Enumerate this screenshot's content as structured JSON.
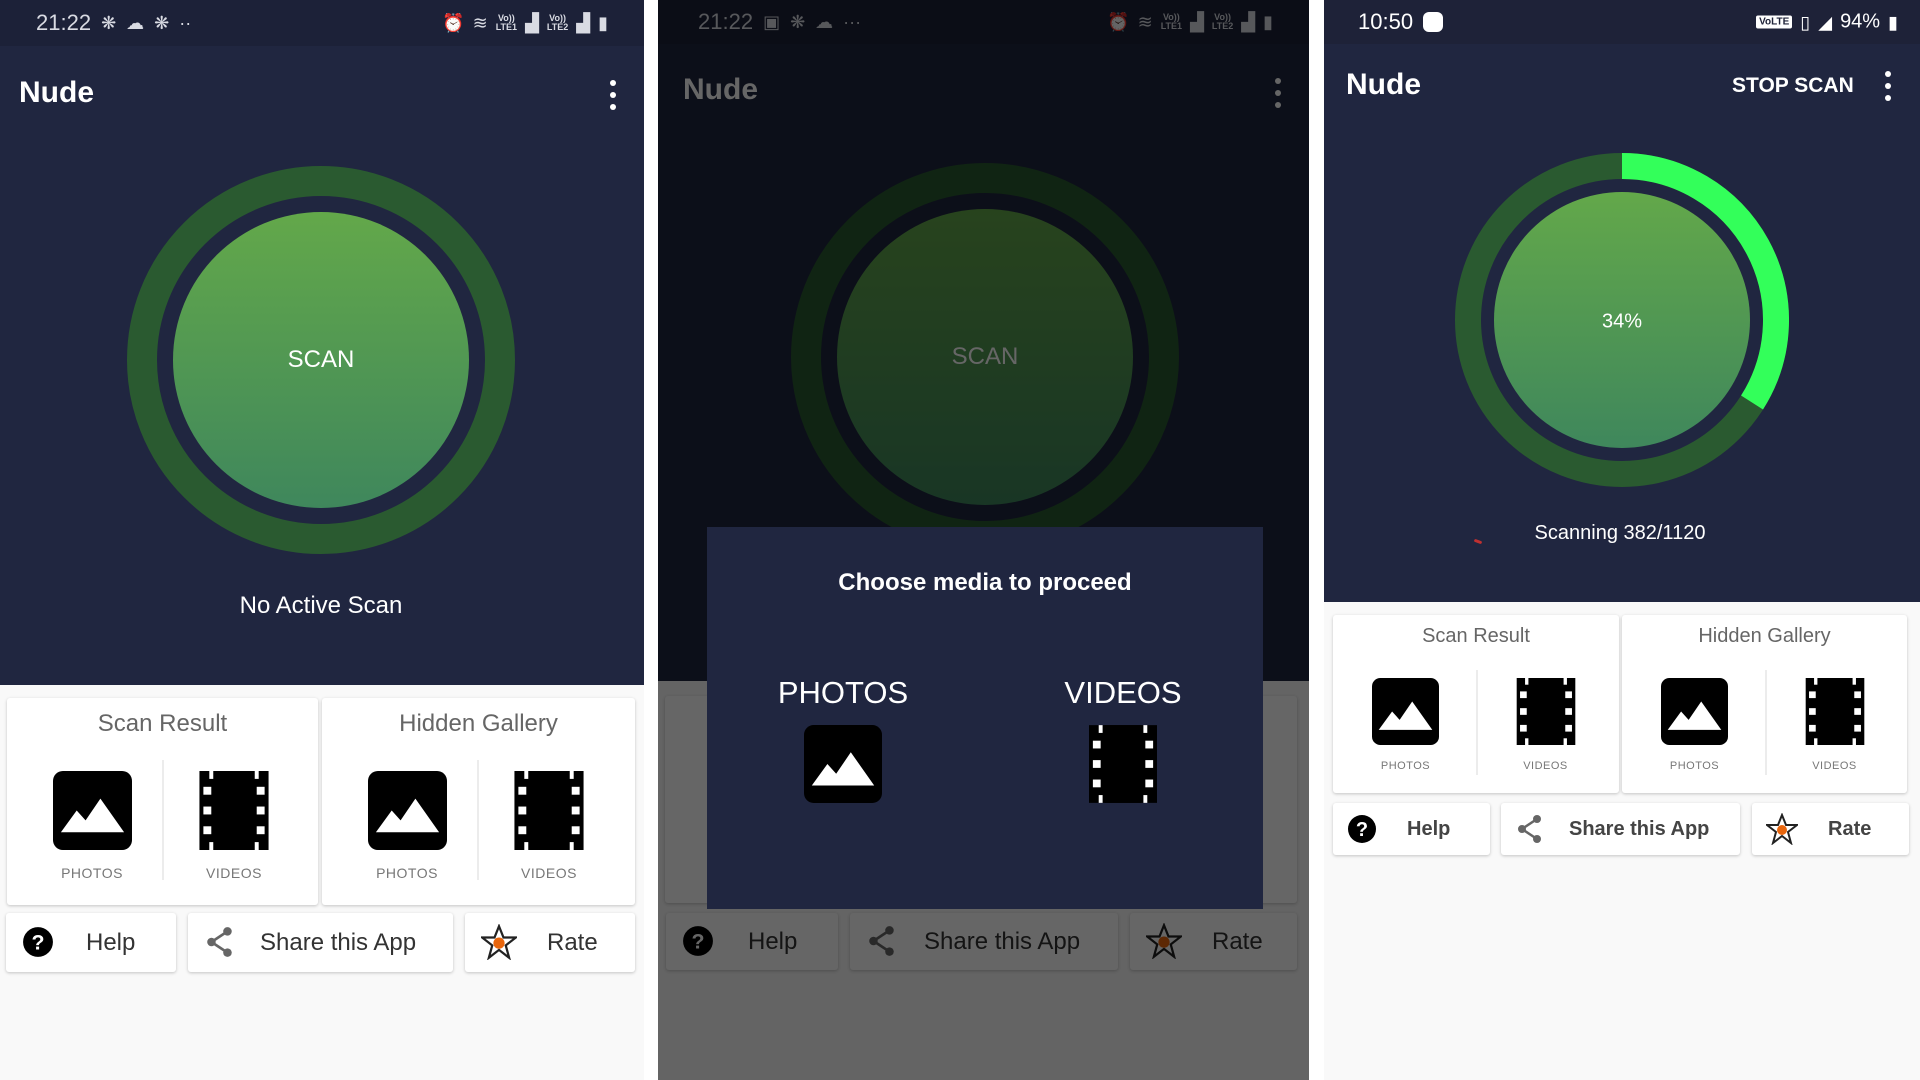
{
  "screens": [
    {
      "status": {
        "time": "21:22",
        "left_icons": [
          "snowflake-icon",
          "weather-sunrise-icon",
          "snowflake-icon",
          "more-dots-icon"
        ],
        "right_icons": [
          "alarm-icon",
          "wifi-icon",
          "volte-lte1-signal-icon",
          "volte-lte2-signal-icon",
          "battery-icon"
        ],
        "lte1": "LTE1",
        "lte2": "LTE2",
        "vol": "Vo))"
      },
      "app_title": "Nude",
      "scan_button_label": "SCAN",
      "scan_status": "No Active Scan"
    },
    {
      "status": {
        "time": "21:22",
        "left_icons": [
          "gallery-icon",
          "snowflake-icon",
          "weather-sunrise-icon",
          "more-dots-icon"
        ],
        "right_icons": [
          "alarm-icon",
          "wifi-icon",
          "volte-lte1-signal-icon",
          "volte-lte2-signal-icon",
          "battery-icon"
        ],
        "lte1": "LTE1",
        "lte2": "LTE2",
        "vol": "Vo))"
      },
      "app_title": "Nude",
      "scan_button_label": "SCAN",
      "dialog": {
        "title": "Choose media to proceed",
        "options": [
          {
            "label": "PHOTOS",
            "icon": "image-icon"
          },
          {
            "label": "VIDEOS",
            "icon": "film-icon"
          }
        ]
      }
    },
    {
      "status": {
        "time": "10:50",
        "left_icons": [
          "notification-square-icon"
        ],
        "volte_badge": "VoLTE",
        "battery_percent": "94%",
        "right_icons": [
          "volte-icon",
          "vibrate-icon",
          "no-signal-icon",
          "battery-icon"
        ]
      },
      "app_title": "Nude",
      "stop_scan_label": "STOP SCAN",
      "progress_label": "34%",
      "progress_fraction": 0.34,
      "scan_status": "Scanning 382/1120"
    }
  ],
  "cards": [
    {
      "title": "Scan Result",
      "items": [
        {
          "label": "PHOTOS",
          "icon": "image-icon"
        },
        {
          "label": "VIDEOS",
          "icon": "film-icon"
        }
      ]
    },
    {
      "title": "Hidden Gallery",
      "items": [
        {
          "label": "PHOTOS",
          "icon": "image-icon"
        },
        {
          "label": "VIDEOS",
          "icon": "film-icon"
        }
      ]
    }
  ],
  "actions": [
    {
      "label": "Help",
      "icon": "help-circle-icon"
    },
    {
      "label": "Share this App",
      "icon": "share-icon"
    },
    {
      "label": "Rate",
      "icon": "star-icon"
    }
  ],
  "colors": {
    "app_bg": "#202640",
    "status_bg": "#1c2138",
    "ring_track": "#2a5a30",
    "ring_progress": "#33ff5a",
    "scan_gradient_top": "#63a84a",
    "scan_gradient_bottom": "#3f875c",
    "star_dot": "#e8650c",
    "page_bg": "#f9f9f9"
  }
}
